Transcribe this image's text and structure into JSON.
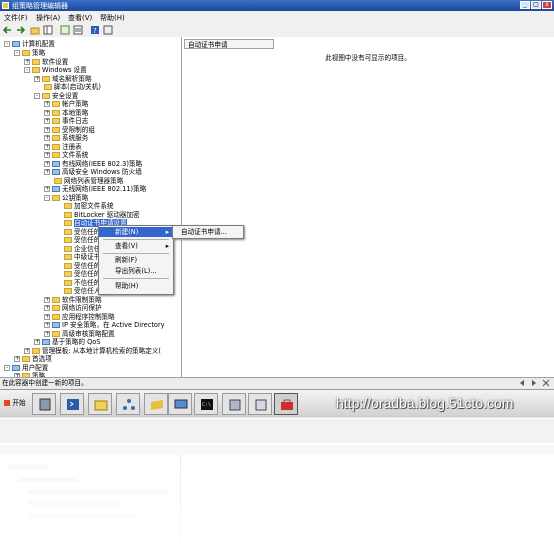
{
  "window": {
    "title": "组策略管理编辑器"
  },
  "menu": {
    "file": "文件(F)",
    "action": "操作(A)",
    "view": "查看(V)",
    "help": "帮助(H)"
  },
  "tree": {
    "n0": "计算机配置",
    "n1": "策略",
    "n2": "软件设置",
    "n3": "Windows 设置",
    "n4": "域名解析策略",
    "n5": "脚本(启动/关机)",
    "n6": "安全设置",
    "n7": "帐户策略",
    "n8": "本地策略",
    "n9": "事件日志",
    "n10": "受限制的组",
    "n11": "系统服务",
    "n12": "注册表",
    "n13": "文件系统",
    "n14": "有线网络(IEEE 802.3)策略",
    "n15": "高级安全 Windows 防火墙",
    "n16": "网络列表管理器策略",
    "n17": "无线网络(IEEE 802.11)策略",
    "n18": "公钥策略",
    "n19": "加密文件系统",
    "n20": "BitLocker 驱动器加密",
    "n21": "自动证书申请设置",
    "n22": "受信任的",
    "n23": "受信任的",
    "n24": "企业信任",
    "n25": "中级证书",
    "n26": "受信任的",
    "n27": "受信任的",
    "n28": "不信任的",
    "n29": "受信任人",
    "n30": "软件限制策略",
    "n31": "网络访问保护",
    "n32": "应用程序控制策略",
    "n33": "IP 安全策略，在 Active Directory",
    "n34": "高级审核策略配置",
    "n35": "基于策略的 QoS",
    "n36": "管理模板: 从本地计算机检索的策略定义(",
    "n37": "首选项",
    "n38": "用户配置",
    "n39": "策略",
    "n40": "首选项"
  },
  "right_pane": {
    "column_header": "自动证书申请",
    "empty_message": "此视图中没有可显示的项目。"
  },
  "context_menu": {
    "new": "新建(N)",
    "view": "查看(V)",
    "refresh": "刷新(F)",
    "export": "导出列表(L)...",
    "help": "帮助(H)"
  },
  "submenu": {
    "auto_cert_request": "自动证书申请..."
  },
  "status": {
    "text": "在此容器中创建一新的项目。"
  },
  "taskbar": {
    "start": "开始"
  },
  "watermark": {
    "text": "http://oradba.blog.51cto.com"
  },
  "icons": [
    "start-icon",
    "server-manager-icon",
    "powershell-icon",
    "explorer-icon",
    "network-icon",
    "folder-icon",
    "rdp-icon",
    "cmd-icon",
    "gpmc-icon",
    "gpo-editor-icon",
    "toolbox-icon"
  ]
}
